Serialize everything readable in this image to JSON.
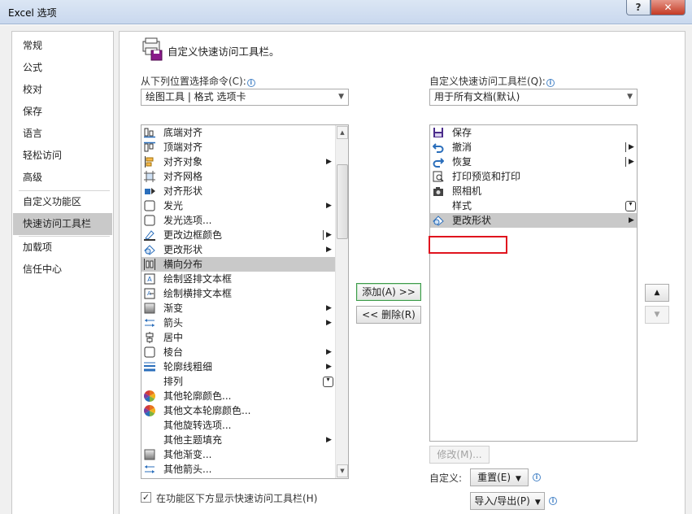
{
  "window": {
    "title": "Excel 选项",
    "help": "?",
    "close": "✕"
  },
  "nav": {
    "items": [
      {
        "label": "常规"
      },
      {
        "label": "公式"
      },
      {
        "label": "校对"
      },
      {
        "label": "保存"
      },
      {
        "label": "语言"
      },
      {
        "label": "轻松访问"
      },
      {
        "label": "高级"
      },
      {
        "label": "自定义功能区"
      },
      {
        "label": "快速访问工具栏"
      },
      {
        "label": "加载项"
      },
      {
        "label": "信任中心"
      }
    ],
    "selected": "快速访问工具栏"
  },
  "header": {
    "title": "自定义快速访问工具栏。"
  },
  "left": {
    "label": "从下列位置选择命令(C):",
    "combo_value": "绘图工具 | 格式 选项卡",
    "items": [
      {
        "label": "底端对齐",
        "icon": "align-bottom-icon"
      },
      {
        "label": "顶端对齐",
        "icon": "align-top-icon"
      },
      {
        "label": "对齐对象",
        "icon": "align-objects-icon",
        "submenu": true
      },
      {
        "label": "对齐网格",
        "icon": "snap-grid-icon"
      },
      {
        "label": "对齐形状",
        "icon": "snap-shape-icon"
      },
      {
        "label": "发光",
        "icon": "glow-icon",
        "submenu": true
      },
      {
        "label": "发光选项...",
        "icon": "glow-options-icon"
      },
      {
        "label": "更改边框颜色",
        "icon": "border-color-icon",
        "split": true
      },
      {
        "label": "更改形状",
        "icon": "change-shape-icon",
        "submenu": true
      },
      {
        "label": "横向分布",
        "icon": "distribute-horizontal-icon",
        "selected": true
      },
      {
        "label": "绘制竖排文本框",
        "icon": "vertical-textbox-icon"
      },
      {
        "label": "绘制横排文本框",
        "icon": "horizontal-textbox-icon"
      },
      {
        "label": "渐变",
        "icon": "gradient-icon",
        "submenu": true
      },
      {
        "label": "箭头",
        "icon": "arrow-icon",
        "submenu": true
      },
      {
        "label": "居中",
        "icon": "align-center-icon"
      },
      {
        "label": "棱台",
        "icon": "bevel-icon",
        "submenu": true
      },
      {
        "label": "轮廓线粗细",
        "icon": "outline-weight-icon",
        "submenu": true
      },
      {
        "label": "排列",
        "icon": "",
        "gallery": true
      },
      {
        "label": "其他轮廓颜色...",
        "icon": "color-wheel-icon"
      },
      {
        "label": "其他文本轮廓颜色...",
        "icon": "color-wheel-icon"
      },
      {
        "label": "其他旋转选项...",
        "icon": ""
      },
      {
        "label": "其他主题填充",
        "icon": "",
        "submenu": true
      },
      {
        "label": "其他渐变...",
        "icon": "gradient-icon"
      },
      {
        "label": "其他箭头...",
        "icon": "arrow-icon"
      }
    ]
  },
  "right": {
    "label": "自定义快速访问工具栏(Q):",
    "combo_value": "用于所有文档(默认)",
    "items": [
      {
        "label": "保存",
        "icon": "save-icon"
      },
      {
        "label": "撤消",
        "icon": "undo-icon",
        "split": true
      },
      {
        "label": "恢复",
        "icon": "redo-icon",
        "split": true
      },
      {
        "label": "打印预览和打印",
        "icon": "print-preview-icon"
      },
      {
        "label": "照相机",
        "icon": "camera-icon"
      },
      {
        "label": "样式",
        "icon": "",
        "gallery": true
      },
      {
        "label": "更改形状",
        "icon": "change-shape-icon",
        "submenu": true,
        "selected": true
      }
    ]
  },
  "buttons": {
    "add": "添加(A) >>",
    "remove": "<< 删除(R)",
    "modify": "修改(M)...",
    "customize_label": "自定义:",
    "reset": "重置(E)",
    "import_export": "导入/导出(P)",
    "move_up": "▲",
    "move_down": "▼"
  },
  "checkbox": {
    "label": "在功能区下方显示快速访问工具栏(H)",
    "checked": true
  },
  "colors": {
    "selection": "#c9c9c9",
    "highlight_box": "#e0141e",
    "default_button_border": "#3d9a4a"
  }
}
